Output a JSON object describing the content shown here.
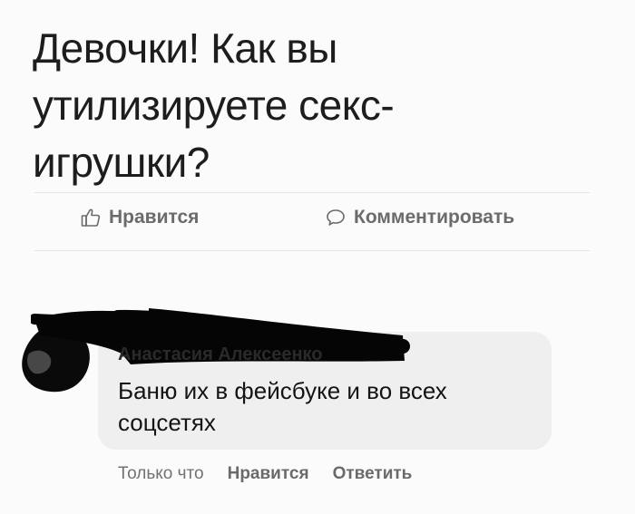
{
  "post": {
    "lines": [
      "Девочки! Как вы",
      "утилизируете секс-",
      "игрушки?"
    ]
  },
  "actions": {
    "like_label": "Нравится",
    "comment_label": "Комментировать"
  },
  "comment": {
    "author": "Анастасия Алексеенко",
    "lines": [
      "Баню их в фейсбуке и во всех",
      "соцсетях"
    ],
    "time": "Только что",
    "like_label": "Нравится",
    "reply_label": "Ответить"
  },
  "icons": {
    "like": "thumbs-up-icon",
    "comment": "speech-bubble-icon"
  },
  "colors": {
    "text": "#1d1d1d",
    "muted": "#6b6b6b",
    "bubble": "#efefef",
    "redaction": "#000000"
  }
}
